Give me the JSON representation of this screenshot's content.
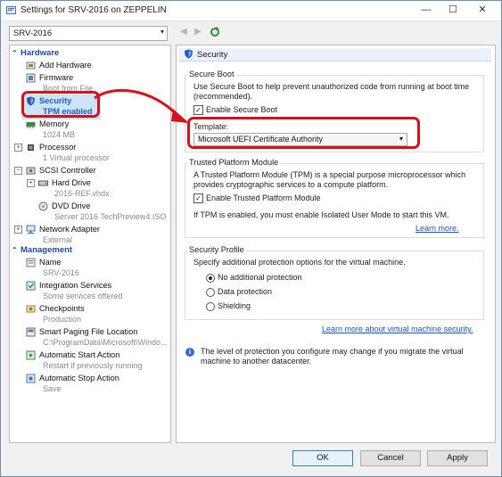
{
  "window": {
    "title": "Settings for SRV-2016 on ZEPPELIN"
  },
  "vm_select": {
    "value": "SRV-2016"
  },
  "hardware": {
    "header": "Hardware",
    "items": [
      {
        "label": "Add Hardware",
        "sub": ""
      },
      {
        "label": "Firmware",
        "sub": "Boot from File"
      },
      {
        "label": "Security",
        "sub": "TPM enabled"
      },
      {
        "label": "Memory",
        "sub": "1024 MB"
      },
      {
        "label": "Processor",
        "sub": "1 Virtual processor"
      },
      {
        "label": "SCSI Controller",
        "sub": ""
      },
      {
        "label": "Hard Drive",
        "sub": "2016-REF.vhdx"
      },
      {
        "label": "DVD Drive",
        "sub": "Server 2016 TechPreview4.ISO"
      },
      {
        "label": "Network Adapter",
        "sub": "External"
      }
    ]
  },
  "management": {
    "header": "Management",
    "items": [
      {
        "label": "Name",
        "sub": "SRV-2016"
      },
      {
        "label": "Integration Services",
        "sub": "Some services offered"
      },
      {
        "label": "Checkpoints",
        "sub": "Production"
      },
      {
        "label": "Smart Paging File Location",
        "sub": "C:\\ProgramData\\Microsoft\\Windo..."
      },
      {
        "label": "Automatic Start Action",
        "sub": "Restart if previously running"
      },
      {
        "label": "Automatic Stop Action",
        "sub": "Save"
      }
    ]
  },
  "security": {
    "header": "Security",
    "secure_boot": {
      "title": "Secure Boot",
      "desc": "Use Secure Boot to help prevent unauthorized code from running at boot time (recommended).",
      "enable_label": "Enable Secure Boot",
      "enabled": true,
      "template_label": "Template:",
      "template_value": "Microsoft UEFI Certificate Authority"
    },
    "tpm": {
      "title": "Trusted Platform Module",
      "desc": "A Trusted Platform Module (TPM) is a special purpose microprocessor which provides cryptographic services to a compute platform.",
      "enable_label": "Enable Trusted Platform Module",
      "enabled": true,
      "note": "If TPM is enabled, you must enable Isolated User Mode to start this VM.",
      "learn_more": "Learn more."
    },
    "profile": {
      "title": "Security Profile",
      "desc": "Specify additional protection options for the virtual machine.",
      "options": [
        "No additional protection",
        "Data protection",
        "Shielding"
      ],
      "selected": "No additional protection"
    },
    "learn_more_vm": "Learn more about virtual machine security.",
    "info": "The level of protection you configure may change if you migrate the virtual machine to another datacenter."
  },
  "buttons": {
    "ok": "OK",
    "cancel": "Cancel",
    "apply": "Apply"
  },
  "colors": {
    "accent": "#1e4b9b",
    "callout": "#d4121a",
    "link": "#1a56b9"
  }
}
